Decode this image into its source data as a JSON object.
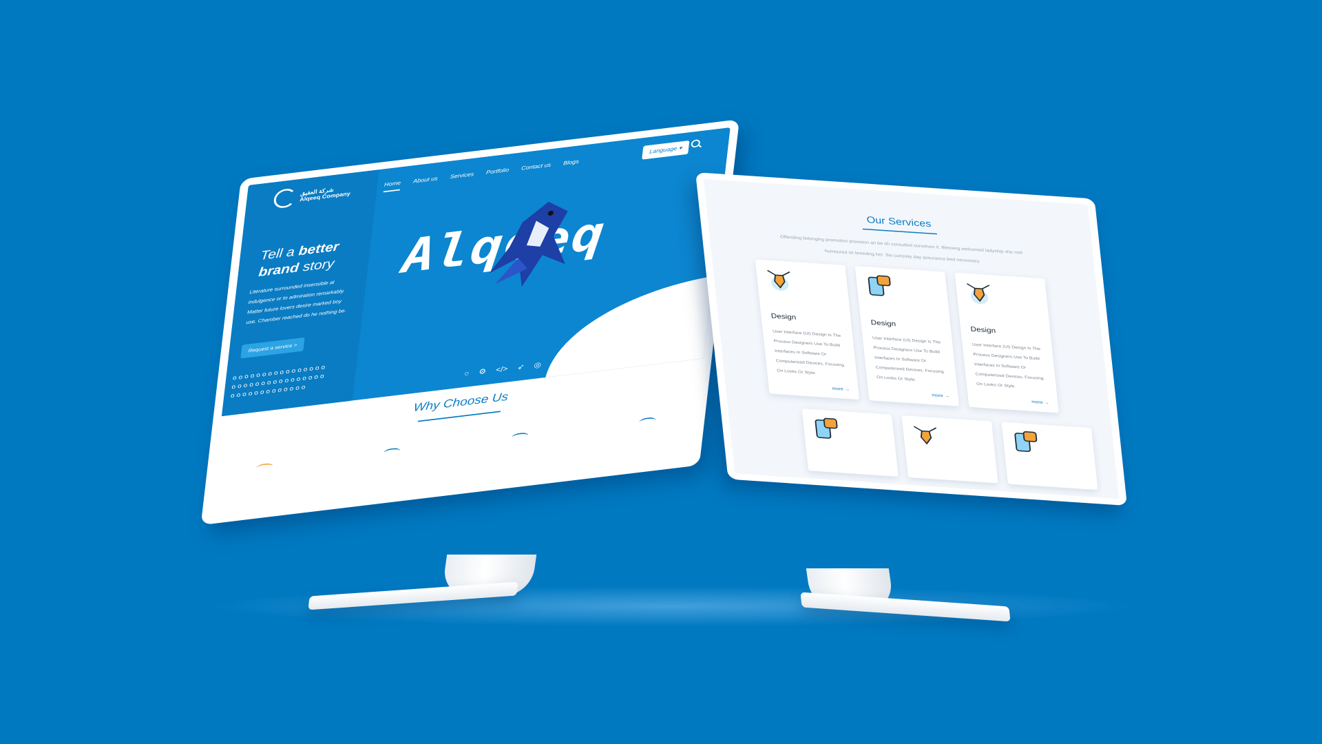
{
  "colors": {
    "background": "#0079C1",
    "brand_blue": "#0A7CC3",
    "accent_orange": "#F3A23C"
  },
  "left_screen": {
    "logo": {
      "arabic": "شركة العقيق",
      "english": "Alqeeq Company"
    },
    "nav": [
      "Home",
      "About us",
      "Services",
      "Portfolio",
      "Contact us",
      "Blogs"
    ],
    "language_label": "Language",
    "hero_title_part1": "Tell a",
    "hero_title_bold1": "better",
    "hero_title_bold2": "brand",
    "hero_title_part2": "story",
    "hero_desc": "Literature surrounded insensible at indulgence or to admiration remarkably. Matter future lovers desire marked boy use. Chamber reached do he nothing be.",
    "request_button": "Request a service >",
    "brand_word": "Alqeeq",
    "why_title": "Why Choose Us"
  },
  "right_screen": {
    "title": "Our Services",
    "description": "Offending belonging promotion provision an be oh consulted ourselves it. Blessing welcomed ladyship she met humoured sir breeding her. Six curiosity day assurance bed necessary.",
    "cards": [
      {
        "icon": "pen-tool-icon",
        "title": "Design",
        "text": "User Interface (UI) Design Is The Process Designers Use To Build Interfaces In Software Or Computerized Devices, Focusing On Looks Or Style.",
        "more": "more →"
      },
      {
        "icon": "mobile-code-icon",
        "title": "Design",
        "text": "User Interface (UI) Design Is The Process Designers Use To Build Interfaces In Software Or Computerized Devices, Focusing On Looks Or Style.",
        "more": "more →"
      },
      {
        "icon": "pen-tool-icon",
        "title": "Design",
        "text": "User Interface (UI) Design Is The Process Designers Use To Build Interfaces In Software Or Computerized Devices, Focusing On Looks Or Style.",
        "more": "more →"
      }
    ]
  }
}
